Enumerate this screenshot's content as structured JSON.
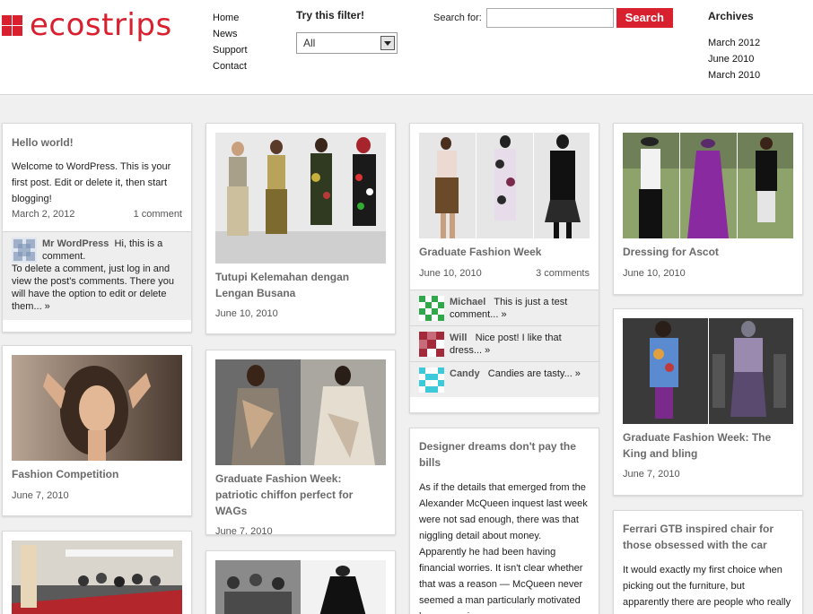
{
  "site": {
    "logo": "ecostrips",
    "accent": "#d8202f"
  },
  "nav": [
    "Home",
    "News",
    "Support",
    "Contact"
  ],
  "filter": {
    "title": "Try this filter!",
    "selected": "All"
  },
  "search": {
    "label": "Search for:",
    "button": "Search",
    "value": ""
  },
  "archives": {
    "title": "Archives",
    "items": [
      "March 2012",
      "June 2010",
      "March 2010"
    ]
  },
  "posts": {
    "hello": {
      "title": "Hello world!",
      "body": "Welcome to WordPress. This is your first post. Edit or delete it, then start blogging!",
      "date": "March 2, 2012",
      "comments": "1 comment",
      "comment_author": "Mr WordPress",
      "comment_text": "Hi, this is a comment.",
      "comment_more": "To delete a comment, just log in and view the post's comments. There you will have the option to edit or delete them... »"
    },
    "fashion_comp": {
      "title": "Fashion Competition",
      "date": "June 7, 2010"
    },
    "tutupi": {
      "title": "Tutupi Kelemahan dengan Lengan Busana",
      "date": "June 10, 2010"
    },
    "patriotic": {
      "title": "Graduate Fashion Week: patriotic chiffon perfect for WAGs",
      "date": "June 7, 2010"
    },
    "grad_week": {
      "title": "Graduate Fashion Week",
      "date": "June 10, 2010",
      "comments": "3 comments",
      "c1_author": "Michael",
      "c1_text": "This is just a test comment... »",
      "c2_author": "Will",
      "c2_text": "Nice post! I like that dress... »",
      "c3_author": "Candy",
      "c3_text": "Candies are tasty... »"
    },
    "designer": {
      "title": "Designer dreams don't pay the bills",
      "body": "As if the details that emerged from the Alexander McQueen inquest last week were not sad enough, there was that niggling detail about money. Apparently he had been having financial worries. It isn't clear whether that was a reason — McQueen never seemed a man particularly motivated by economic"
    },
    "ascot": {
      "title": "Dressing for Ascot",
      "date": "June 10, 2010"
    },
    "king_bling": {
      "title": "Graduate Fashion Week: The King and bling",
      "date": "June 7, 2010"
    },
    "ferrari": {
      "title": "Ferrari GTB inspired chair for those obsessed with the car",
      "body": "It would exactly my first choice when picking out the furniture, but apparently there are people who really like to have"
    }
  }
}
